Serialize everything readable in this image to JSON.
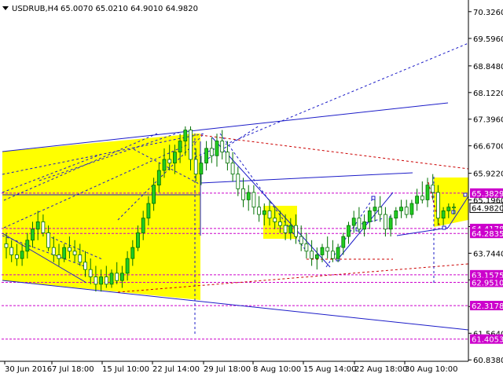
{
  "header": {
    "symbol": "USDRUB,H4",
    "values": "65.0070 65.0210 64.9010 64.9820"
  },
  "chart_data": {
    "type": "candlestick",
    "ylim": [
      60.8,
      70.6
    ],
    "y_ticks": [
      "70.3260",
      "69.5960",
      "68.8480",
      "68.1220",
      "67.3960",
      "66.6700",
      "65.9220",
      "65.1960",
      "64.4700",
      "63.7440",
      "63.0180",
      "62.2920",
      "61.5640",
      "60.8380"
    ],
    "x_ticks": [
      "30 Jun 2016",
      "7 Jul 18:00",
      "15 Jul 10:00",
      "22 Jul 14:00",
      "29 Jul 18:00",
      "8 Aug 10:00",
      "15 Aug 14:00",
      "22 Aug 18:00",
      "30 Aug 10:00"
    ],
    "current_price": {
      "label": "64.9820",
      "value": 64.982
    },
    "levels": [
      {
        "label": "65.3829",
        "value": 65.3829,
        "color": "#cc00cc"
      },
      {
        "label": "64.4178",
        "value": 64.4178,
        "color": "#cc00cc"
      },
      {
        "label": "64.2835",
        "value": 64.2835,
        "color": "#cc00cc"
      },
      {
        "label": "63.1575",
        "value": 63.1575,
        "color": "#cc00cc"
      },
      {
        "label": "62.9510",
        "value": 62.951,
        "color": "#cc00cc"
      },
      {
        "label": "62.3178",
        "value": 62.3178,
        "color": "#cc00cc"
      },
      {
        "label": "61.4053",
        "value": 61.4053,
        "color": "#cc00cc"
      }
    ],
    "series": [
      {
        "values": [
          [
            0,
            64.0,
            64.3,
            63.6,
            63.9
          ],
          [
            1,
            63.9,
            64.1,
            63.5,
            63.7
          ],
          [
            2,
            63.7,
            64.0,
            63.4,
            63.6
          ],
          [
            3,
            63.6,
            64.0,
            63.4,
            63.8
          ],
          [
            4,
            63.8,
            64.3,
            63.6,
            64.1
          ],
          [
            5,
            64.1,
            64.6,
            63.9,
            64.4
          ],
          [
            6,
            64.4,
            64.9,
            64.1,
            64.6
          ],
          [
            7,
            64.6,
            64.8,
            64.2,
            64.3
          ],
          [
            8,
            64.3,
            64.5,
            63.8,
            63.9
          ],
          [
            9,
            63.9,
            64.2,
            63.5,
            63.7
          ],
          [
            10,
            63.7,
            64.0,
            63.4,
            63.6
          ],
          [
            11,
            63.6,
            64.0,
            63.5,
            63.9
          ],
          [
            12,
            63.9,
            64.2,
            63.6,
            63.8
          ],
          [
            13,
            63.8,
            64.1,
            63.5,
            63.7
          ],
          [
            14,
            63.7,
            64.0,
            63.4,
            63.5
          ],
          [
            15,
            63.5,
            63.8,
            63.1,
            63.3
          ],
          [
            16,
            63.3,
            63.6,
            62.9,
            63.1
          ],
          [
            17,
            63.1,
            63.4,
            62.7,
            62.9
          ],
          [
            18,
            62.9,
            63.3,
            62.7,
            63.1
          ],
          [
            19,
            63.1,
            63.4,
            62.8,
            62.9
          ],
          [
            20,
            62.9,
            63.3,
            62.8,
            63.2
          ],
          [
            21,
            63.2,
            63.5,
            62.9,
            63.0
          ],
          [
            22,
            63.0,
            63.4,
            62.8,
            63.2
          ],
          [
            23,
            63.2,
            63.8,
            63.0,
            63.6
          ],
          [
            24,
            63.6,
            64.1,
            63.4,
            63.9
          ],
          [
            25,
            63.9,
            64.5,
            63.8,
            64.3
          ],
          [
            26,
            64.3,
            64.9,
            64.1,
            64.7
          ],
          [
            27,
            64.7,
            65.3,
            64.5,
            65.1
          ],
          [
            28,
            65.1,
            65.8,
            64.9,
            65.6
          ],
          [
            29,
            65.6,
            66.2,
            65.4,
            66.0
          ],
          [
            30,
            66.0,
            66.6,
            65.8,
            66.3
          ],
          [
            31,
            66.3,
            66.7,
            66.0,
            66.2
          ],
          [
            32,
            66.2,
            66.7,
            65.9,
            66.5
          ],
          [
            33,
            66.5,
            67.0,
            66.2,
            66.8
          ],
          [
            34,
            66.8,
            67.2,
            66.4,
            67.1
          ],
          [
            35,
            67.1,
            67.2,
            66.0,
            66.3
          ],
          [
            36,
            66.3,
            66.6,
            65.7,
            65.9
          ],
          [
            37,
            65.9,
            66.4,
            65.6,
            66.2
          ],
          [
            38,
            66.2,
            66.8,
            66.0,
            66.6
          ],
          [
            39,
            66.6,
            66.9,
            66.2,
            66.4
          ],
          [
            40,
            66.4,
            67.0,
            66.1,
            66.8
          ],
          [
            41,
            66.8,
            67.1,
            66.3,
            66.5
          ],
          [
            42,
            66.5,
            66.8,
            66.0,
            66.2
          ],
          [
            43,
            66.2,
            66.5,
            65.7,
            65.9
          ],
          [
            44,
            65.9,
            66.1,
            65.3,
            65.5
          ],
          [
            45,
            65.5,
            65.8,
            65.0,
            65.2
          ],
          [
            46,
            65.2,
            65.6,
            64.9,
            65.4
          ],
          [
            47,
            65.4,
            65.6,
            64.8,
            65.0
          ],
          [
            48,
            65.0,
            65.3,
            64.6,
            64.8
          ],
          [
            49,
            64.8,
            65.1,
            64.5,
            64.9
          ],
          [
            50,
            64.9,
            65.2,
            64.5,
            64.7
          ],
          [
            51,
            64.7,
            65.0,
            64.4,
            64.6
          ],
          [
            52,
            64.6,
            64.9,
            64.3,
            64.5
          ],
          [
            53,
            64.5,
            64.8,
            64.1,
            64.3
          ],
          [
            54,
            64.3,
            64.7,
            64.1,
            64.5
          ],
          [
            55,
            64.5,
            64.8,
            64.0,
            64.2
          ],
          [
            56,
            64.2,
            64.5,
            63.8,
            64.0
          ],
          [
            57,
            64.0,
            64.3,
            63.6,
            63.8
          ],
          [
            58,
            63.8,
            64.1,
            63.4,
            63.6
          ],
          [
            59,
            63.6,
            63.9,
            63.3,
            63.7
          ],
          [
            60,
            63.7,
            64.0,
            63.5,
            63.9
          ],
          [
            61,
            63.9,
            64.2,
            63.6,
            63.8
          ],
          [
            62,
            63.8,
            64.1,
            63.5,
            63.6
          ],
          [
            63,
            63.6,
            64.0,
            63.5,
            63.9
          ],
          [
            64,
            63.9,
            64.3,
            63.7,
            64.2
          ],
          [
            65,
            64.2,
            64.6,
            64.0,
            64.5
          ],
          [
            66,
            64.5,
            64.9,
            64.3,
            64.7
          ],
          [
            67,
            64.7,
            65.0,
            64.3,
            64.4
          ],
          [
            68,
            64.4,
            64.8,
            64.2,
            64.6
          ],
          [
            69,
            64.6,
            65.0,
            64.4,
            64.9
          ],
          [
            70,
            64.9,
            65.2,
            64.6,
            65.0
          ],
          [
            71,
            65.0,
            65.3,
            64.6,
            64.8
          ],
          [
            72,
            64.8,
            65.0,
            64.2,
            64.4
          ],
          [
            73,
            64.4,
            64.8,
            64.2,
            64.7
          ],
          [
            74,
            64.7,
            65.0,
            64.5,
            64.9
          ],
          [
            75,
            64.9,
            65.2,
            64.7,
            65.0
          ],
          [
            76,
            65.0,
            65.2,
            64.7,
            64.8
          ],
          [
            77,
            64.8,
            65.2,
            64.7,
            65.1
          ],
          [
            78,
            65.1,
            65.5,
            64.9,
            65.3
          ],
          [
            79,
            65.3,
            65.7,
            65.1,
            65.2
          ],
          [
            80,
            65.2,
            65.8,
            65.0,
            65.6
          ],
          [
            81,
            65.6,
            65.9,
            65.2,
            65.4
          ],
          [
            82,
            65.4,
            65.6,
            64.5,
            64.7
          ],
          [
            83,
            64.7,
            65.0,
            64.5,
            64.9
          ],
          [
            84,
            64.9,
            65.1,
            64.7,
            65.0
          ],
          [
            85,
            65.0,
            65.1,
            64.8,
            64.98
          ]
        ]
      }
    ]
  }
}
